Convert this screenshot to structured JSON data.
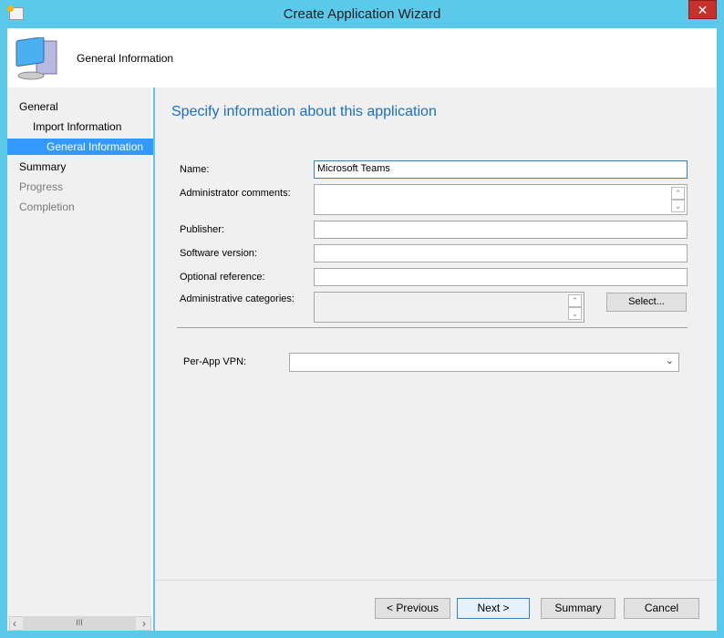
{
  "window": {
    "title": "Create Application Wizard",
    "close_label": "✕"
  },
  "header": {
    "title": "General Information"
  },
  "sidebar": {
    "items": [
      {
        "label": "General",
        "state": "normal"
      },
      {
        "label": "Import Information",
        "state": "normal"
      },
      {
        "label": "General Information",
        "state": "selected"
      },
      {
        "label": "Summary",
        "state": "normal"
      },
      {
        "label": "Progress",
        "state": "disabled"
      },
      {
        "label": "Completion",
        "state": "disabled"
      }
    ],
    "scroll_left": "‹",
    "scroll_thumb": "III",
    "scroll_right": "›"
  },
  "main": {
    "heading": "Specify information about this application",
    "fields": {
      "name": {
        "label": "Name:",
        "value": "Microsoft Teams"
      },
      "admin_comments": {
        "label": "Administrator comments:",
        "value": ""
      },
      "publisher": {
        "label": "Publisher:",
        "value": ""
      },
      "software_version": {
        "label": "Software version:",
        "value": ""
      },
      "optional_reference": {
        "label": "Optional reference:",
        "value": ""
      },
      "admin_categories": {
        "label": "Administrative categories:",
        "value": ""
      },
      "per_app_vpn": {
        "label": "Per-App VPN:",
        "value": ""
      }
    },
    "select_button": "Select...",
    "spin_up": "⌃",
    "spin_down": "⌄",
    "dropdown_arrow": "⌄"
  },
  "footer": {
    "previous": "< Previous",
    "next": "Next >",
    "summary": "Summary",
    "cancel": "Cancel"
  }
}
